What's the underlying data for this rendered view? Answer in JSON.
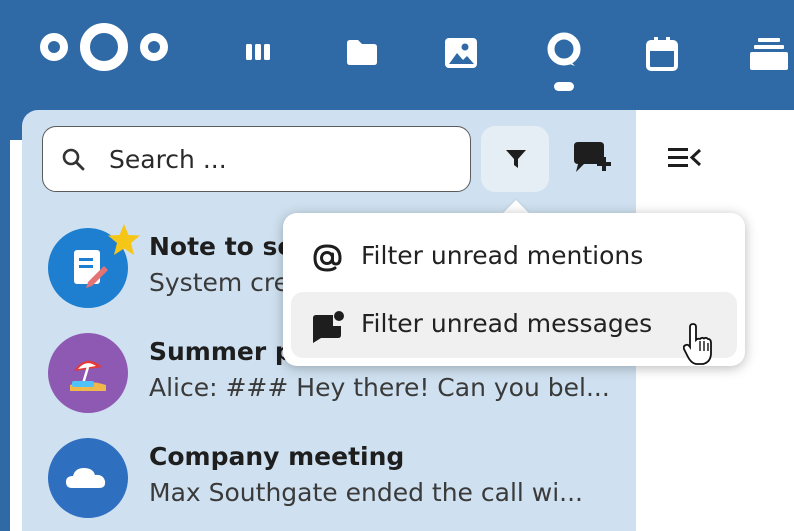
{
  "search": {
    "placeholder": "Search ..."
  },
  "app_icons": [
    "logo-icon",
    "dashboard-icon",
    "files-icon",
    "photos-icon",
    "talk-icon",
    "calendar-icon",
    "deck-icon"
  ],
  "filter_menu": {
    "items": [
      {
        "label": "Filter unread mentions",
        "icon": "at-icon"
      },
      {
        "label": "Filter unread messages",
        "icon": "message-badge-icon"
      }
    ]
  },
  "conversations": [
    {
      "title": "Note to se",
      "subtitle": "System cre",
      "avatar_color": "#1e7fd0",
      "favorite": true
    },
    {
      "title": "Summer p",
      "subtitle": "Alice: ### Hey there! Can you bel...",
      "avatar_color": "#8e59b3",
      "favorite": false
    },
    {
      "title": "Company meeting",
      "subtitle": "Max Southgate ended the call wi...",
      "avatar_color": "#2f6fc0",
      "favorite": false
    }
  ],
  "colors": {
    "header": "#2f6aa6",
    "sidebar": "#cfe1f0",
    "star": "#f5c518"
  }
}
